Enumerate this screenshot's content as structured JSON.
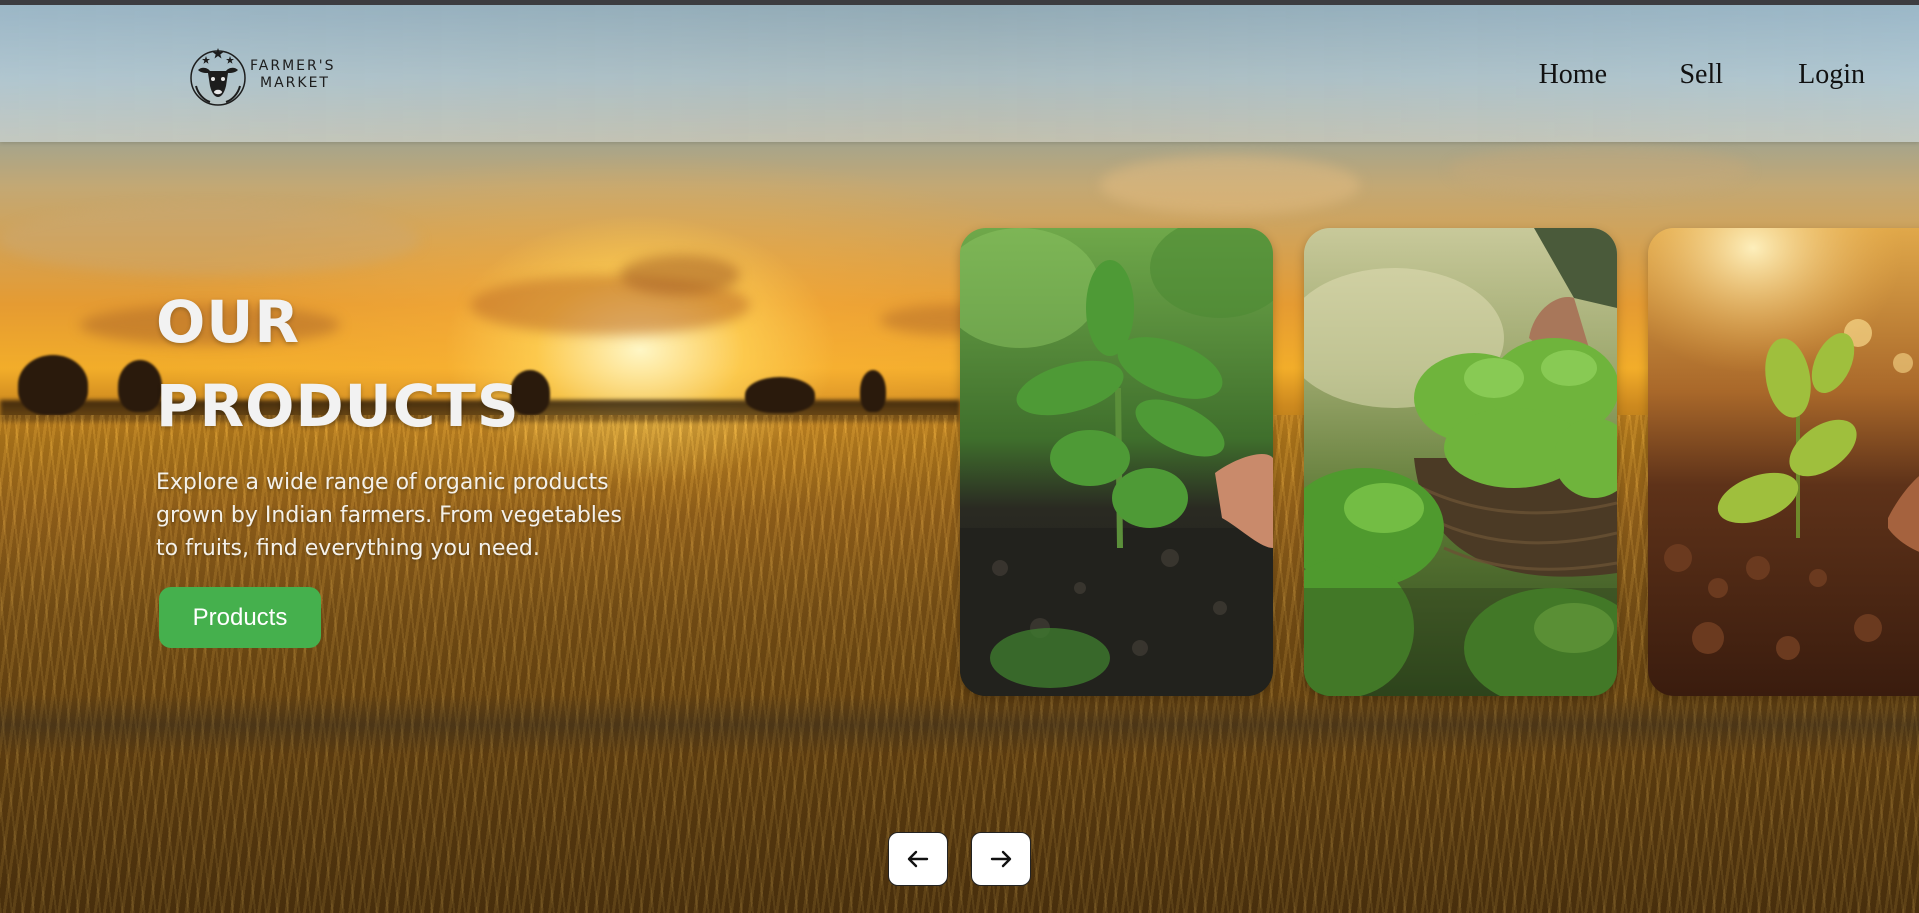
{
  "header": {
    "logo": {
      "line1": "FARMER'S",
      "line2": "MARKET",
      "icon": "farmers-market-logo-icon"
    },
    "nav": [
      {
        "label": "Home"
      },
      {
        "label": "Sell"
      },
      {
        "label": "Login"
      }
    ]
  },
  "hero": {
    "title": "OUR PRODUCTS",
    "description": "Explore a wide range of organic products grown by Indian farmers. From vegetables to fruits, find everything you need.",
    "button_label": "Products"
  },
  "carousel": {
    "cards": [
      {
        "image": "seedling-in-soil-with-hand"
      },
      {
        "image": "basket-of-lettuce-harvest"
      },
      {
        "image": "sprout-in-sunset-soil"
      }
    ],
    "prev_icon": "arrow-left-icon",
    "next_icon": "arrow-right-icon"
  },
  "colors": {
    "button_green": "#45b04d",
    "text_light": "#f2f2f2"
  }
}
